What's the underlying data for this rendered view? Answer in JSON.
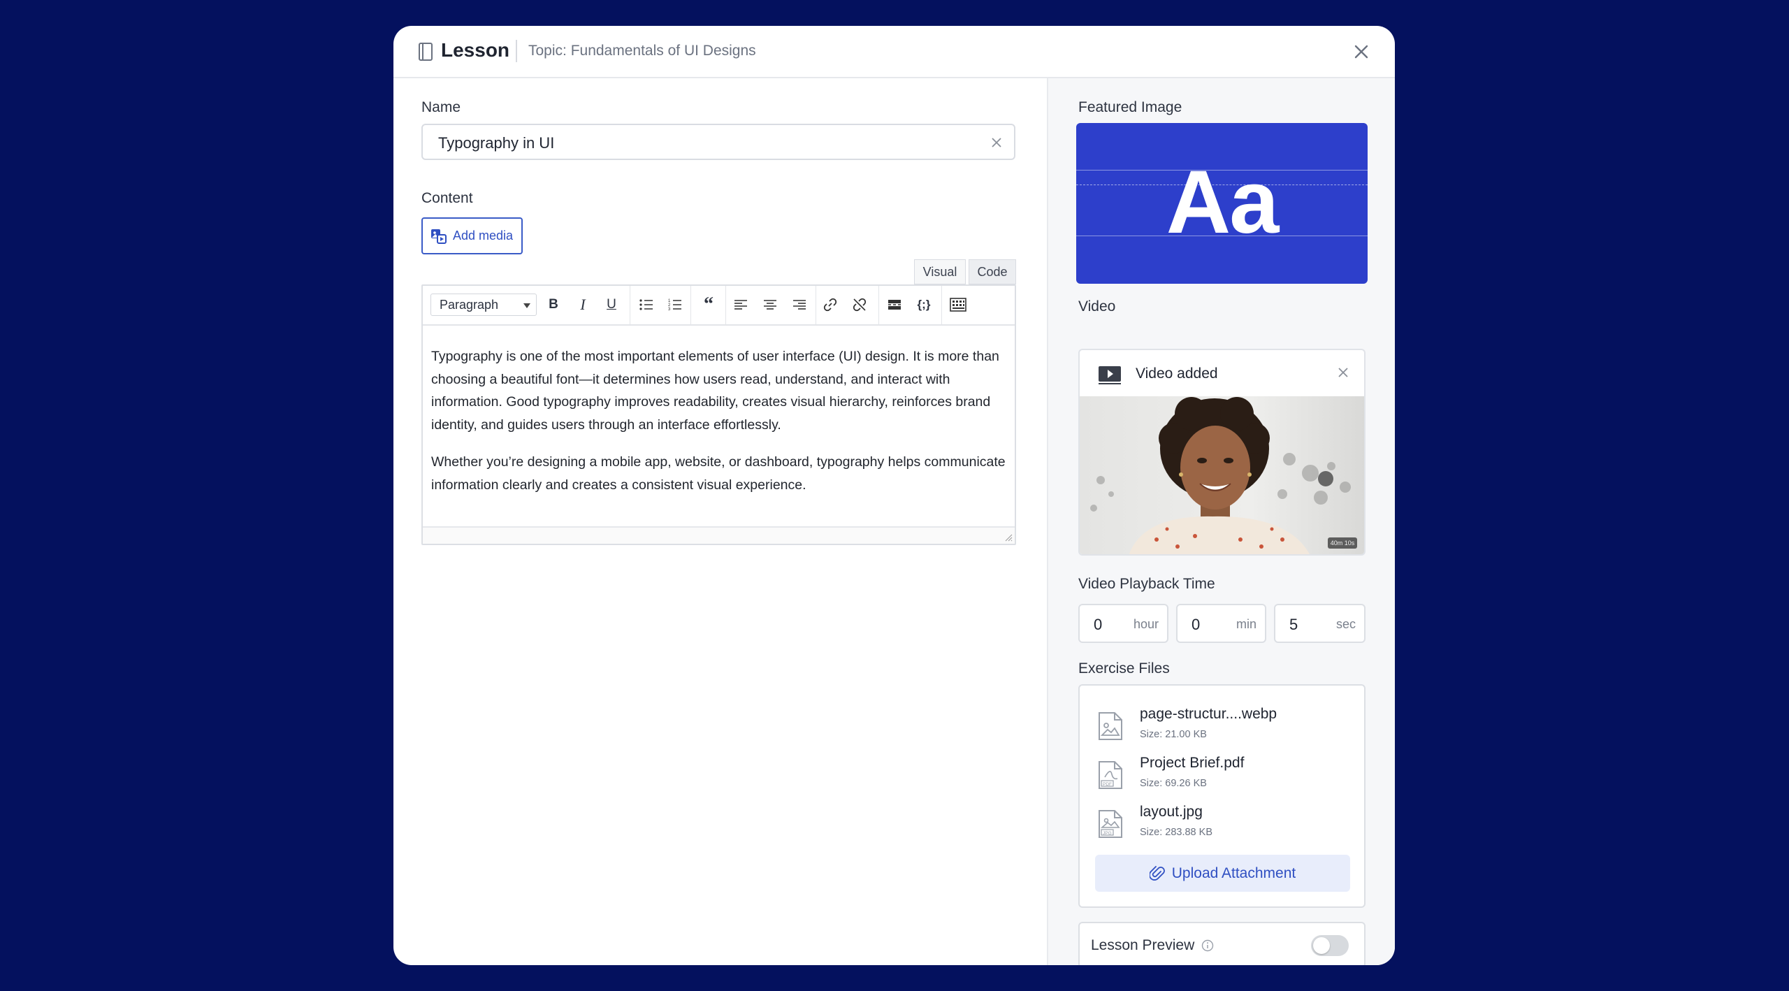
{
  "header": {
    "title": "Lesson",
    "topic": "Topic: Fundamentals of UI Designs"
  },
  "form": {
    "name_label": "Name",
    "name_value": "Typography in UI",
    "content_label": "Content",
    "add_media_label": "Add media",
    "tabs": {
      "visual": "Visual",
      "code": "Code"
    },
    "format_select": "Paragraph",
    "paragraphs": [
      "Typography is one of the most important elements of user interface (UI) design. It is more than choosing a beautiful font—it determines how users read, understand, and interact with information. Good typography improves readability, creates visual hierarchy, reinforces brand identity, and guides users through an interface effortlessly.",
      "Whether you’re designing a mobile app, website, or dashboard, typography helps communicate information clearly and creates a consistent visual experience."
    ]
  },
  "sidebar": {
    "featured_label": "Featured Image",
    "featured_text": "Aa",
    "featured_color": "#2d3fcb",
    "video_label": "Video",
    "video_status": "Video added",
    "video_duration": "40m 10s",
    "playback_label": "Video Playback Time",
    "playback": [
      {
        "value": "0",
        "unit": "hour"
      },
      {
        "value": "0",
        "unit": "min"
      },
      {
        "value": "5",
        "unit": "sec"
      }
    ],
    "files_label": "Exercise Files",
    "files": [
      {
        "name": "page-structur....webp",
        "size": "Size: 21.00 KB",
        "icon": "image-file-icon"
      },
      {
        "name": "Project Brief.pdf",
        "size": "Size: 69.26 KB",
        "icon": "pdf-file-icon"
      },
      {
        "name": "layout.jpg",
        "size": "Size: 283.88 KB",
        "icon": "jpg-file-icon"
      }
    ],
    "upload_label": "Upload Attachment",
    "preview_label": "Lesson Preview",
    "preview_enabled": false
  },
  "colors": {
    "backdrop": "#04115e",
    "accent": "#2f4fc2",
    "upload_bg": "#e8edfb"
  }
}
